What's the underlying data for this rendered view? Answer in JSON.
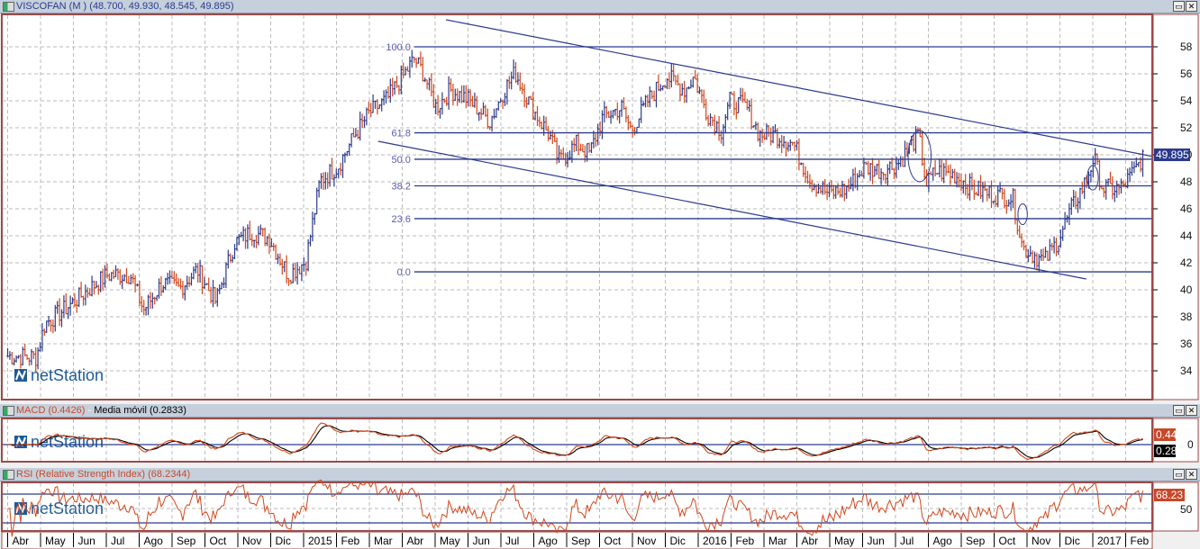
{
  "main_panel": {
    "title": "VISCOFAN (M ) (48.700, 49.930, 48.545, 49.895)",
    "last_price_label": "49.895",
    "watermark": "netStation"
  },
  "macd_panel": {
    "title_macd": "MACD (0.4426)",
    "title_sep": " - ",
    "title_signal": "Media móvil (0.2833)",
    "macd_label": "0.44",
    "signal_label": "0.28",
    "axis_label": "0"
  },
  "rsi_panel": {
    "title": "RSI (Relative Strength Index) (68.2344)",
    "value_label": "68.23",
    "axis_label": "50"
  },
  "window_buttons": {
    "maximize": "▭",
    "close": "✕"
  },
  "colors": {
    "up": "#2b3a8c",
    "down": "#d2461a",
    "signal": "#000000",
    "macd": "#d2461a",
    "level_line": "#2b3a8c",
    "frame": "#9b4a4a"
  },
  "chart_data": [
    {
      "type": "ohlc",
      "title": "VISCOFAN (M )",
      "last_bar": {
        "open": 48.7,
        "high": 49.93,
        "low": 48.545,
        "close": 49.895
      },
      "ylim": [
        32.5,
        60.5
      ],
      "yticks": [
        "34",
        "36",
        "38",
        "40",
        "42",
        "44",
        "46",
        "48",
        "50",
        "52",
        "54",
        "56",
        "58"
      ],
      "grid": true,
      "x_tick_labels": [
        "Abr",
        "May",
        "Jun",
        "Jul",
        "Ago",
        "Sep",
        "Oct",
        "Nov",
        "Dic",
        "2015",
        "Feb",
        "Mar",
        "Abr",
        "May",
        "Jun",
        "Jul",
        "Ago",
        "Sep",
        "Oct",
        "Nov",
        "Dic",
        "2016",
        "Feb",
        "Mar",
        "Abr",
        "May",
        "Jun",
        "Jul",
        "Ago",
        "Sep",
        "Oct",
        "Nov",
        "Dic",
        "2017",
        "Feb"
      ],
      "xlim": [
        "2014-04-01",
        "2017-02-28"
      ],
      "series": [
        [
          "2014-04-01",
          35.1
        ],
        [
          "2014-04-27",
          35.0
        ],
        [
          "2014-05-05",
          37.5
        ],
        [
          "2014-05-22",
          38.5
        ],
        [
          "2014-06-16",
          40.1
        ],
        [
          "2014-07-02",
          41.1
        ],
        [
          "2014-07-23",
          41.1
        ],
        [
          "2014-08-05",
          38.5
        ],
        [
          "2014-08-22",
          40.5
        ],
        [
          "2014-09-08",
          40.1
        ],
        [
          "2014-09-24",
          41.5
        ],
        [
          "2014-10-11",
          39.1
        ],
        [
          "2014-10-28",
          43.5
        ],
        [
          "2014-11-14",
          44.3
        ],
        [
          "2014-11-30",
          43.8
        ],
        [
          "2014-12-17",
          41.1
        ],
        [
          "2015-01-03",
          42.1
        ],
        [
          "2015-01-16",
          48.1
        ],
        [
          "2015-02-02",
          49.1
        ],
        [
          "2015-02-18",
          51.5
        ],
        [
          "2015-03-01",
          53.1
        ],
        [
          "2015-03-17",
          54.1
        ],
        [
          "2015-04-04",
          56.1
        ],
        [
          "2015-04-12",
          57.1
        ],
        [
          "2015-04-20",
          56.1
        ],
        [
          "2015-05-02",
          53.5
        ],
        [
          "2015-05-15",
          54.8
        ],
        [
          "2015-06-01",
          54.1
        ],
        [
          "2015-06-21",
          52.5
        ],
        [
          "2015-07-04",
          54.8
        ],
        [
          "2015-07-14",
          56.1
        ],
        [
          "2015-07-29",
          53.5
        ],
        [
          "2015-08-15",
          51.5
        ],
        [
          "2015-08-24",
          49.5
        ],
        [
          "2015-09-10",
          50.8
        ],
        [
          "2015-09-22",
          50.1
        ],
        [
          "2015-10-04",
          52.8
        ],
        [
          "2015-10-21",
          53.5
        ],
        [
          "2015-10-30",
          51.8
        ],
        [
          "2015-11-15",
          54.0
        ],
        [
          "2015-12-02",
          55.8
        ],
        [
          "2015-12-19",
          54.8
        ],
        [
          "2015-12-27",
          55.8
        ],
        [
          "2016-01-09",
          53.1
        ],
        [
          "2016-01-22",
          51.8
        ],
        [
          "2016-01-30",
          54.0
        ],
        [
          "2016-02-15",
          53.5
        ],
        [
          "2016-02-27",
          51.5
        ],
        [
          "2016-03-11",
          51.5
        ],
        [
          "2016-03-28",
          50.8
        ],
        [
          "2016-04-13",
          48.1
        ],
        [
          "2016-04-30",
          47.1
        ],
        [
          "2016-05-17",
          47.5
        ],
        [
          "2016-06-03",
          49.1
        ],
        [
          "2016-06-19",
          48.8
        ],
        [
          "2016-07-05",
          49.5
        ],
        [
          "2016-07-22",
          51.5
        ],
        [
          "2016-07-29",
          47.8
        ],
        [
          "2016-08-08",
          48.8
        ],
        [
          "2016-08-25",
          48.5
        ],
        [
          "2016-09-11",
          47.5
        ],
        [
          "2016-09-28",
          47.1
        ],
        [
          "2016-10-18",
          46.8
        ],
        [
          "2016-10-27",
          43.1
        ],
        [
          "2016-11-09",
          42.5
        ],
        [
          "2016-11-17",
          42.1
        ],
        [
          "2016-11-30",
          43.8
        ],
        [
          "2016-12-12",
          46.1
        ],
        [
          "2016-12-25",
          48.1
        ],
        [
          "2017-01-02",
          49.8
        ],
        [
          "2017-01-10",
          47.5
        ],
        [
          "2017-01-27",
          47.5
        ],
        [
          "2017-02-09",
          48.8
        ],
        [
          "2017-02-17",
          49.895
        ]
      ],
      "fibonacci": {
        "start": "2015-04-12",
        "levels": [
          {
            "label": "100.0",
            "price": 58.0
          },
          {
            "label": "61.8",
            "price": 51.63
          },
          {
            "label": "50.0",
            "price": 49.67
          },
          {
            "label": "38.2",
            "price": 47.7
          },
          {
            "label": "23.6",
            "price": 45.27
          },
          {
            "label": "0.0",
            "price": 41.33
          }
        ]
      },
      "trend_lines": [
        {
          "from": [
            "2015-05-11",
            60.0
          ],
          "to": [
            "2017-02-25",
            49.9
          ]
        },
        {
          "from": [
            "2015-03-09",
            51.0
          ],
          "to": [
            "2016-12-25",
            40.8
          ]
        }
      ],
      "ellipses": [
        {
          "center": [
            "2016-07-23",
            49.9
          ],
          "price_span": 2.7
        },
        {
          "center": [
            "2016-10-27",
            45.6
          ],
          "price_span": 1.1
        },
        {
          "center": [
            "2017-01-01",
            48.3
          ],
          "price_span": 1.3
        }
      ]
    },
    {
      "type": "line",
      "title": "MACD",
      "series": [
        {
          "name": "MACD",
          "last": 0.4426
        },
        {
          "name": "Media móvil",
          "last": 0.2833
        }
      ],
      "yticks": [
        "0"
      ],
      "grid": true
    },
    {
      "type": "line",
      "title": "RSI (Relative Strength Index)",
      "series": [
        {
          "name": "RSI",
          "last": 68.2344
        }
      ],
      "levels": [
        70,
        30
      ],
      "yticks": [
        "50"
      ],
      "grid": true
    }
  ]
}
